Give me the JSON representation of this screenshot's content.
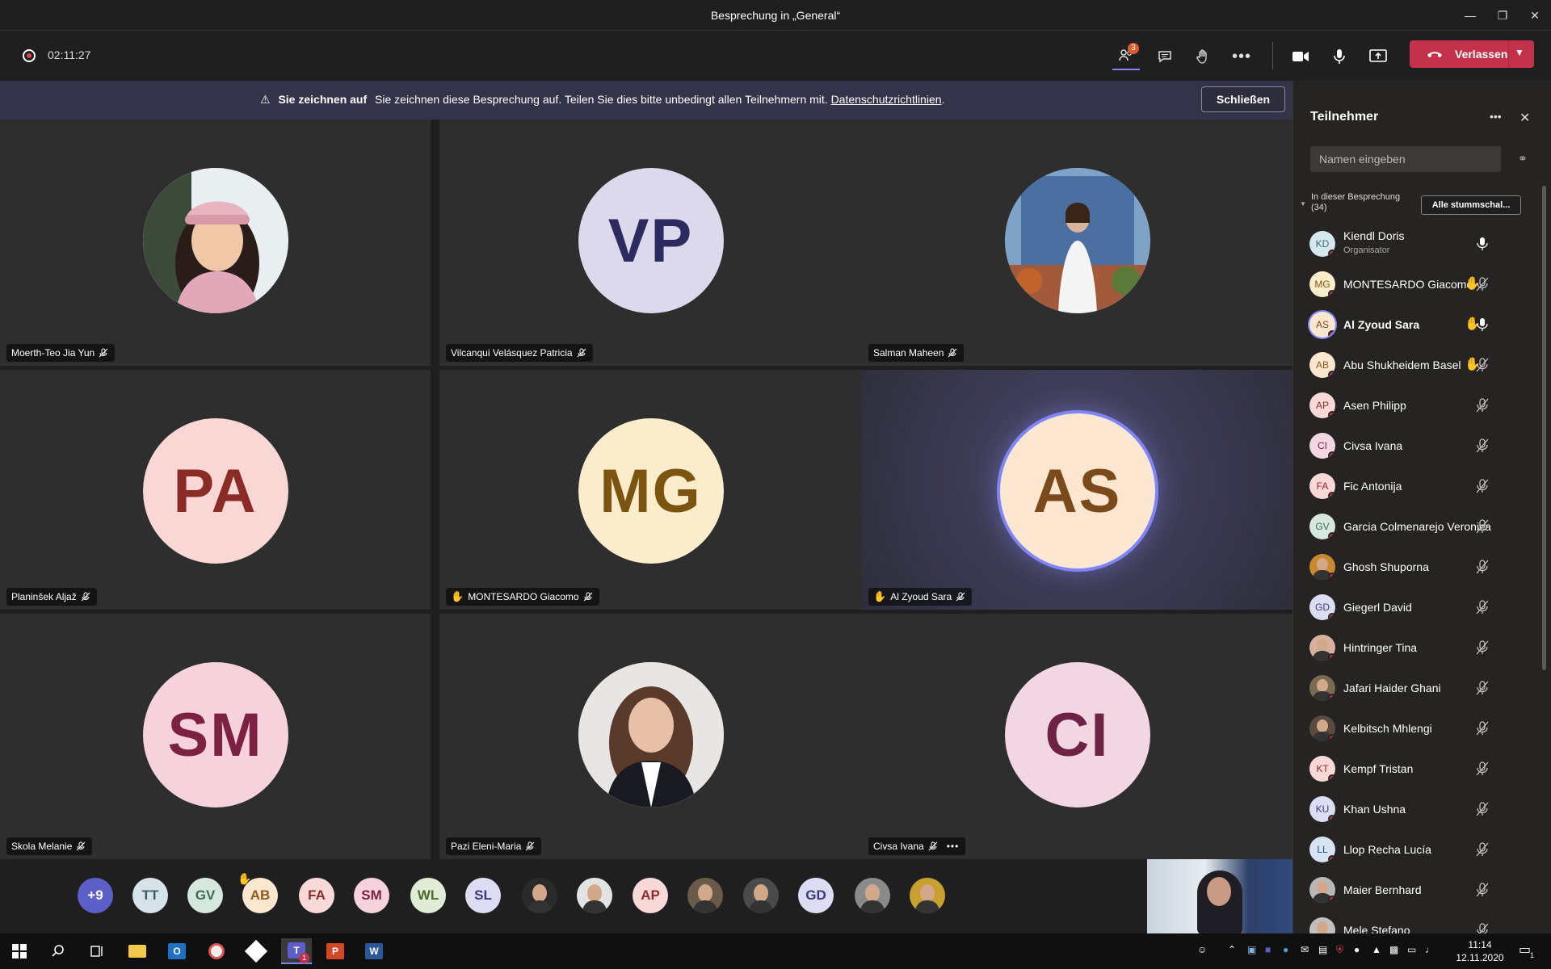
{
  "window": {
    "title": "Besprechung in „General“"
  },
  "meeting": {
    "timer": "02:11:27",
    "participants_badge": "3",
    "leave_label": "Verlassen"
  },
  "banner": {
    "bold": "Sie zeichnen auf",
    "text": "Sie zeichnen diese Besprechung auf. Teilen Sie dies bitte unbedingt allen Teilnehmern mit.",
    "link": "Datenschutzrichtlinien",
    "close_label": "Schließen"
  },
  "tiles": [
    {
      "name": "Moerth-Teo Jia Yun",
      "initials": "",
      "photo": "photo-woman-pink-hat",
      "bg": "#f4d6e0",
      "fg": "#8a3048",
      "hand": false
    },
    {
      "name": "Vilcanqui Velásquez Patricia",
      "initials": "VP",
      "bg": "#dcd9ec",
      "fg": "#2c2a5e",
      "hand": false
    },
    {
      "name": "Salman Maheen",
      "initials": "",
      "photo": "photo-woman-outdoor",
      "bg": "#7fa3c7",
      "fg": "#333",
      "hand": false
    },
    {
      "name": "Planinšek Aljaž",
      "initials": "PA",
      "bg": "#f9d7d4",
      "fg": "#8a2c25",
      "hand": false
    },
    {
      "name": "MONTESARDO Giacomo",
      "initials": "MG",
      "bg": "#fbeccb",
      "fg": "#7a5410",
      "hand": true
    },
    {
      "name": "Al Zyoud Sara",
      "initials": "AS",
      "bg": "#fce6d0",
      "fg": "#7a4a1c",
      "hand": true
    },
    {
      "name": "Skola Melanie",
      "initials": "SM",
      "bg": "#f5d2dc",
      "fg": "#7c2142",
      "hand": false
    },
    {
      "name": "Pazi Eleni-Maria",
      "initials": "",
      "photo": "photo-woman-portrait",
      "bg": "#e8e6e4",
      "fg": "#333",
      "hand": false
    },
    {
      "name": "Civsa Ivana",
      "initials": "CI",
      "bg": "#f2d7e3",
      "fg": "#6e2345",
      "hand": false
    }
  ],
  "strip": [
    {
      "label": "+9",
      "bg": "#5b5fc7",
      "fg": "#fff"
    },
    {
      "label": "TT",
      "bg": "#d6e4ea",
      "fg": "#3b5b6b"
    },
    {
      "label": "GV",
      "bg": "#d6e7e0",
      "fg": "#3c6b5a"
    },
    {
      "label": "AB",
      "bg": "#fbe7cf",
      "fg": "#8a5c1e",
      "hand": true
    },
    {
      "label": "FA",
      "bg": "#f9d8d8",
      "fg": "#8a2c2c"
    },
    {
      "label": "SM",
      "bg": "#f5d2dc",
      "fg": "#7c2142"
    },
    {
      "label": "WL",
      "bg": "#e0ecd6",
      "fg": "#4b6a2c"
    },
    {
      "label": "SL",
      "bg": "#dcdcf2",
      "fg": "#3a3a7a"
    },
    {
      "label": "",
      "photo": true,
      "bg": "#2a2a2a",
      "fg": "#fff"
    },
    {
      "label": "",
      "photo": true,
      "bg": "#e3e3e3",
      "fg": "#fff"
    },
    {
      "label": "AP",
      "bg": "#f9d8d8",
      "fg": "#8a2c2c"
    },
    {
      "label": "",
      "photo": true,
      "bg": "#6a5a4a",
      "fg": "#fff"
    },
    {
      "label": "",
      "photo": true,
      "bg": "#4a4a4a",
      "fg": "#fff"
    },
    {
      "label": "GD",
      "bg": "#dcdcf2",
      "fg": "#3a3a7a"
    },
    {
      "label": "",
      "photo": true,
      "bg": "#8a8a8a",
      "fg": "#fff"
    },
    {
      "label": "",
      "photo": true,
      "bg": "#c8a030",
      "fg": "#fff"
    }
  ],
  "panel": {
    "title": "Teilnehmer",
    "search_placeholder": "Namen eingeben",
    "section": "In dieser Besprechung",
    "count": "(34)",
    "mute_all": "Alle stummschal...",
    "participants": [
      {
        "name": "Kiendl Doris",
        "role": "Organisator",
        "initials": "KD",
        "bg": "#d6e8ee",
        "fg": "#3b6b7b",
        "hand": false,
        "mic": "on"
      },
      {
        "name": "MONTESARDO Giacomo",
        "initials": "MG",
        "bg": "#fbeccb",
        "fg": "#7a5410",
        "hand": true,
        "mic": "off"
      },
      {
        "name": "Al Zyoud Sara",
        "initials": "AS",
        "bg": "#fce6d0",
        "fg": "#7a4a1c",
        "hand": true,
        "mic": "on",
        "bold": true
      },
      {
        "name": "Abu Shukheidem Basel",
        "initials": "AB",
        "bg": "#fbe7cf",
        "fg": "#8a5c1e",
        "hand": true,
        "mic": "off"
      },
      {
        "name": "Asen Philipp",
        "initials": "AP",
        "bg": "#f9d8d8",
        "fg": "#8a2c2c",
        "hand": false,
        "mic": "off"
      },
      {
        "name": "Civsa Ivana",
        "initials": "CI",
        "bg": "#f2d7e3",
        "fg": "#6e2345",
        "hand": false,
        "mic": "off"
      },
      {
        "name": "Fic Antonija",
        "initials": "FA",
        "bg": "#f9d8d8",
        "fg": "#8a2c2c",
        "hand": false,
        "mic": "off"
      },
      {
        "name": "Garcia Colmenarejo Veronica",
        "initials": "GV",
        "bg": "#d6e7e0",
        "fg": "#3c6b5a",
        "hand": false,
        "mic": "off"
      },
      {
        "name": "Ghosh Shuporna",
        "initials": "",
        "photo": true,
        "bg": "#c88a30",
        "fg": "#fff",
        "hand": false,
        "mic": "off"
      },
      {
        "name": "Giegerl David",
        "initials": "GD",
        "bg": "#dcdcf2",
        "fg": "#3a3a7a",
        "hand": false,
        "mic": "off"
      },
      {
        "name": "Hintringer Tina",
        "initials": "",
        "photo": true,
        "bg": "#d8b0a0",
        "fg": "#fff",
        "hand": false,
        "mic": "off"
      },
      {
        "name": "Jafari Haider Ghani",
        "initials": "",
        "photo": true,
        "bg": "#7a6a50",
        "fg": "#fff",
        "hand": false,
        "mic": "off"
      },
      {
        "name": "Kelbitsch Mhlengi",
        "initials": "",
        "photo": true,
        "bg": "#5a4a40",
        "fg": "#fff",
        "hand": false,
        "mic": "off"
      },
      {
        "name": "Kempf Tristan",
        "initials": "KT",
        "bg": "#f9d8d8",
        "fg": "#8a2c2c",
        "hand": false,
        "mic": "off"
      },
      {
        "name": "Khan Ushna",
        "initials": "KU",
        "bg": "#dcdcf2",
        "fg": "#3a3a7a",
        "hand": false,
        "mic": "off"
      },
      {
        "name": "Llop Recha Lucía",
        "initials": "LL",
        "bg": "#d6e4f2",
        "fg": "#2c4a7a",
        "hand": false,
        "mic": "off"
      },
      {
        "name": "Maier Bernhard",
        "initials": "",
        "photo": true,
        "bg": "#b8b8b8",
        "fg": "#fff",
        "hand": false,
        "mic": "off"
      },
      {
        "name": "Mele Stefano",
        "initials": "",
        "photo": true,
        "bg": "#c0c0c0",
        "fg": "#fff",
        "hand": false,
        "mic": "off"
      }
    ]
  },
  "taskbar": {
    "time": "11:14",
    "date": "12.11.2020",
    "teams_badge": "1",
    "notif_badge": "1"
  }
}
